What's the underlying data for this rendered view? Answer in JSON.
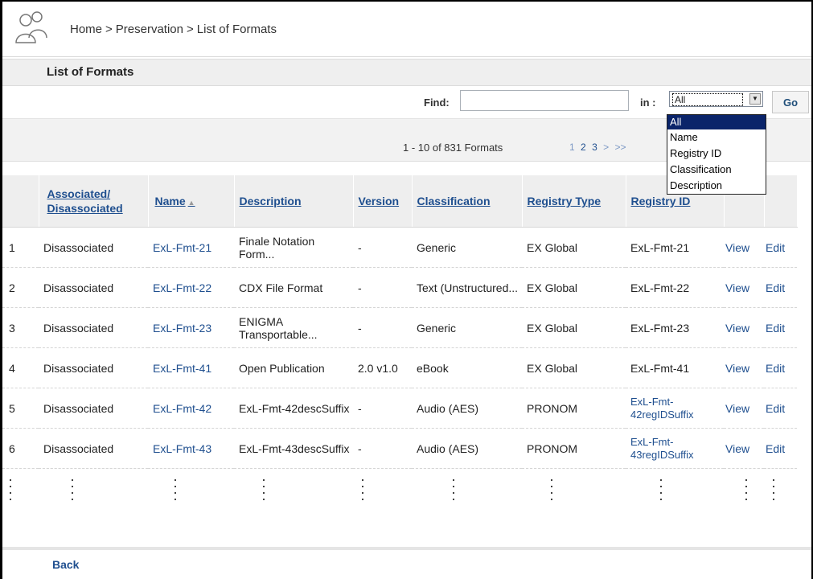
{
  "breadcrumb": [
    "Home",
    ">",
    "Preservation",
    ">",
    "List of Formats"
  ],
  "page_title": "List of Formats",
  "find": {
    "label": "Find:",
    "value": "",
    "in_label": "in :",
    "selected": "All",
    "go": "Go",
    "options": [
      "All",
      "Name",
      "Registry ID",
      "Classification",
      "Description"
    ]
  },
  "pager": {
    "range": "1 - 10 of 831 Formats",
    "pages": [
      "1",
      "2",
      "3",
      ">",
      ">>"
    ]
  },
  "table": {
    "headers": [
      "Associated/ Disassociated",
      "Name",
      "Description",
      "Version",
      "Classification",
      "Registry Type",
      "Registry ID"
    ],
    "rows": [
      {
        "n": "1",
        "assoc": "Disassociated",
        "name": "ExL-Fmt-21",
        "desc": "Finale Notation Form...",
        "ver": "-",
        "cls": "Generic",
        "rtype": "EX Global",
        "rid": "ExL-Fmt-21",
        "view": "View",
        "edit": "Edit"
      },
      {
        "n": "2",
        "assoc": "Disassociated",
        "name": "ExL-Fmt-22",
        "desc": "CDX File Format",
        "ver": "-",
        "cls": "Text (Unstructured...",
        "rtype": "EX Global",
        "rid": "ExL-Fmt-22",
        "view": "View",
        "edit": "Edit"
      },
      {
        "n": "3",
        "assoc": "Disassociated",
        "name": "ExL-Fmt-23",
        "desc": "ENIGMA Transportable...",
        "ver": "-",
        "cls": "Generic",
        "rtype": "EX Global",
        "rid": "ExL-Fmt-23",
        "view": "View",
        "edit": "Edit"
      },
      {
        "n": "4",
        "assoc": "Disassociated",
        "name": "ExL-Fmt-41",
        "desc": "Open Publication",
        "ver": "2.0 v1.0",
        "cls": "eBook",
        "rtype": "EX Global",
        "rid": "ExL-Fmt-41",
        "view": "View",
        "edit": "Edit"
      },
      {
        "n": "5",
        "assoc": "Disassociated",
        "name": "ExL-Fmt-42",
        "desc": "ExL-Fmt-42descSuffix",
        "ver": "-",
        "cls": "Audio (AES)",
        "rtype": "PRONOM",
        "rid": "ExL-Fmt-42regIDSuffix",
        "view": "View",
        "edit": "Edit"
      },
      {
        "n": "6",
        "assoc": "Disassociated",
        "name": "ExL-Fmt-43",
        "desc": "ExL-Fmt-43descSuffix",
        "ver": "-",
        "cls": "Audio (AES)",
        "rtype": "PRONOM",
        "rid": "ExL-Fmt-43regIDSuffix",
        "view": "View",
        "edit": "Edit"
      }
    ]
  },
  "back": "Back"
}
